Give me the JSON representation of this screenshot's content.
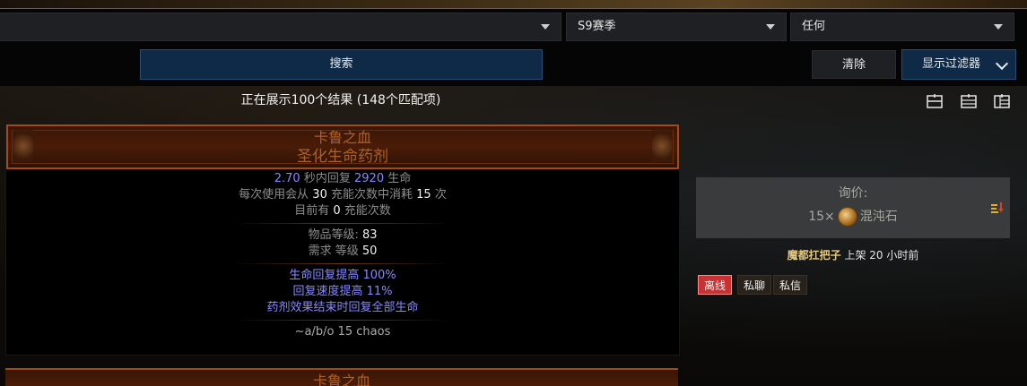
{
  "filters": {
    "league_select": "S9赛季",
    "status_select": "任何"
  },
  "actions": {
    "search_label": "搜索",
    "clear_label": "清除",
    "show_filters_label": "显示过滤器"
  },
  "results": {
    "summary": "正在展示100个结果 (148个匹配项)",
    "layout_icons": [
      "layout-list-icon",
      "layout-compact-icon",
      "layout-grid-icon"
    ]
  },
  "item": {
    "name": "卡鲁之血",
    "base_type": "圣化生命药剂",
    "recover": {
      "amount_time": "2.70",
      "text1": "秒内回复",
      "amount": "2920",
      "text2": "生命"
    },
    "charges_use": {
      "pre": "每次使用会从",
      "count": "30",
      "mid": "充能次数中消耗",
      "cost": "15",
      "post": "次"
    },
    "charges_now": {
      "pre": "目前有",
      "count": "0",
      "post": "充能次数"
    },
    "item_level": {
      "label": "物品等级:",
      "value": "83"
    },
    "requirement": {
      "label": "需求 等级",
      "value": "50"
    },
    "mods": [
      {
        "text": "生命回复提高",
        "value": "100%"
      },
      {
        "text": "回复速度提高",
        "value": "11%"
      },
      {
        "text": "药剂效果结束时回复全部生命",
        "value": ""
      }
    ],
    "note": "~a/b/o 15 chaos"
  },
  "next_item": {
    "name": "卡鲁之血"
  },
  "listing": {
    "price_label": "询价:",
    "price_qty": "15×",
    "price_currency": "混沌石",
    "currency_icon": "chaos-orb-icon",
    "seller_name": "魔都扛把子",
    "listed_text": "上架 20 小时前",
    "tags": {
      "offline": "离线",
      "whisper": "私聊",
      "pm": "私信"
    }
  },
  "colors": {
    "unique": "#af6025",
    "magic": "#8888ff",
    "button": "#0f2a47",
    "offline": "#c83232"
  }
}
